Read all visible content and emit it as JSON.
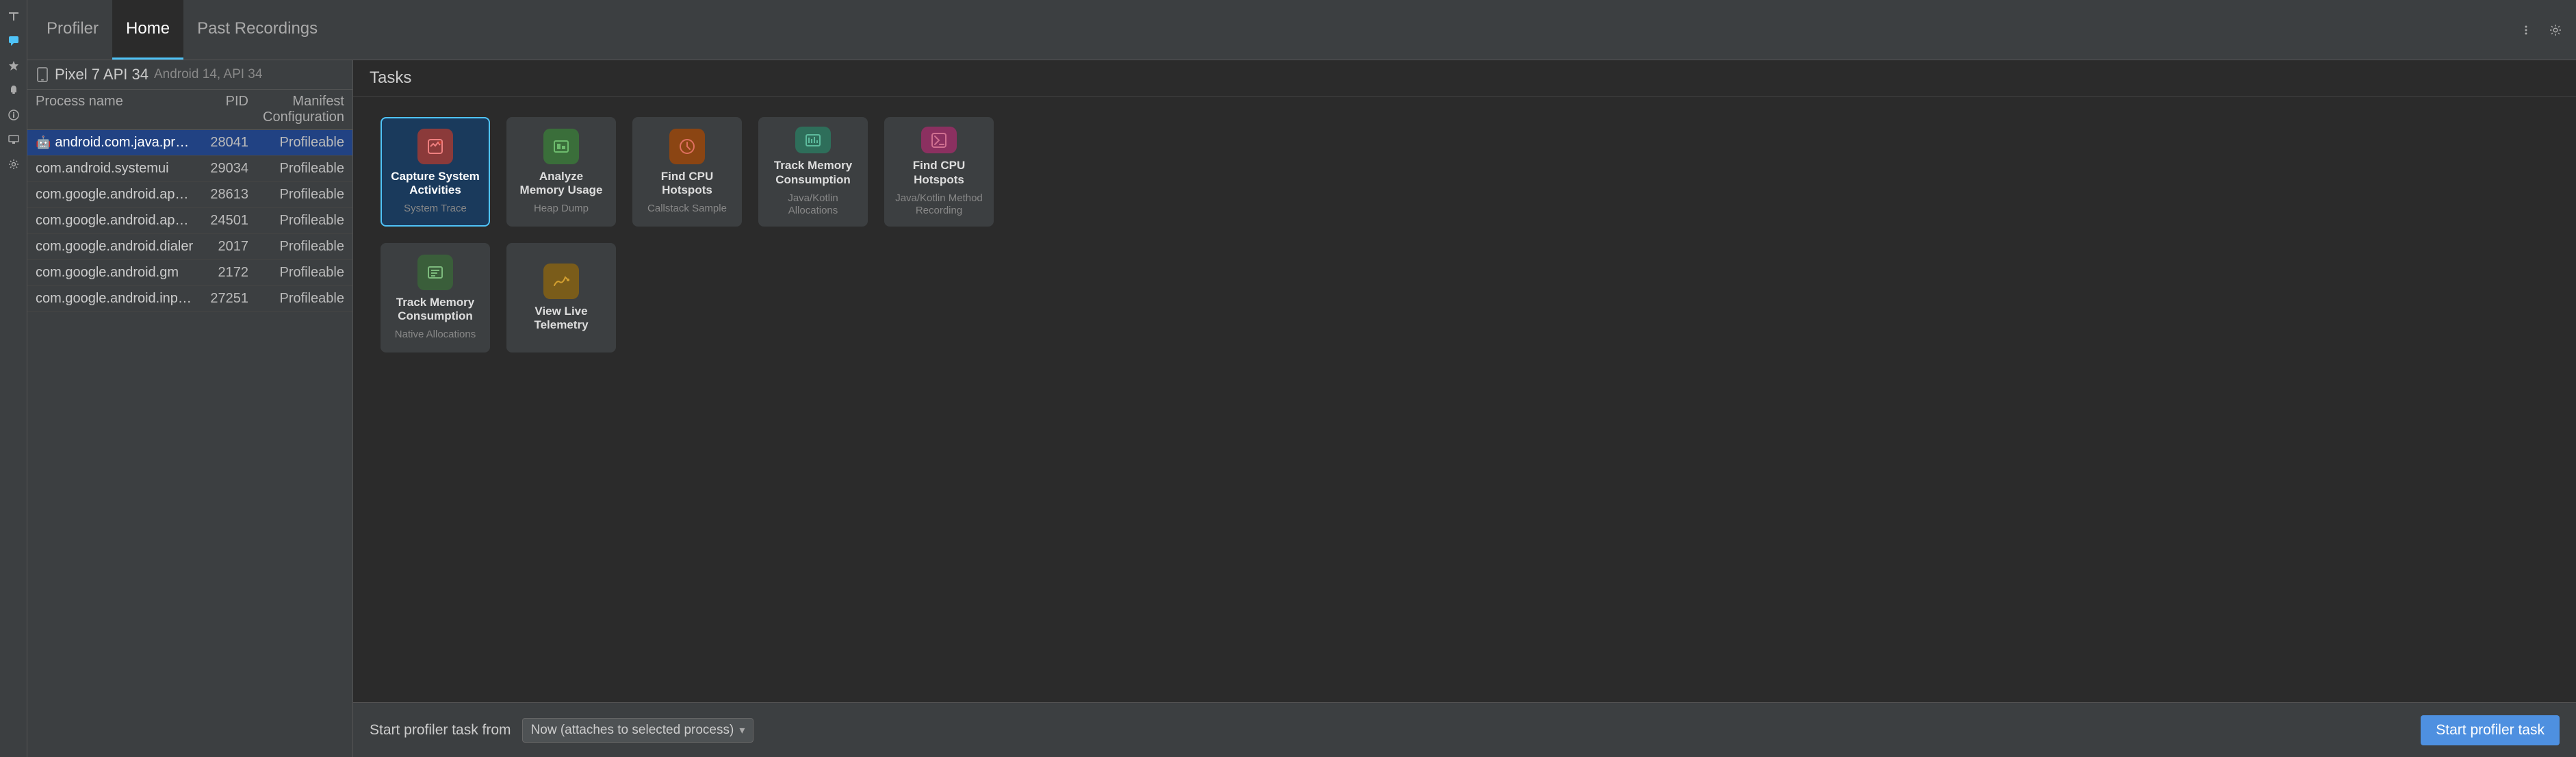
{
  "tabs": {
    "profiler": "Profiler",
    "home": "Home",
    "past_recordings": "Past Recordings"
  },
  "device": {
    "name": "Pixel 7 API 34",
    "sub": "Android 14, API 34"
  },
  "table": {
    "headers": [
      "Process name",
      "PID",
      "Manifest Configuration"
    ],
    "rows": [
      {
        "name": "android.com.java.profilertester",
        "pid": "28041",
        "manifest": "Profileable",
        "selected": true
      },
      {
        "name": "com.android.systemui",
        "pid": "29034",
        "manifest": "Profileable",
        "selected": false
      },
      {
        "name": "com.google.android.apps.messaging",
        "pid": "28613",
        "manifest": "Profileable",
        "selected": false
      },
      {
        "name": "com.google.android.apps.messaging...",
        "pid": "24501",
        "manifest": "Profileable",
        "selected": false
      },
      {
        "name": "com.google.android.dialer",
        "pid": "2017",
        "manifest": "Profileable",
        "selected": false
      },
      {
        "name": "com.google.android.gm",
        "pid": "2172",
        "manifest": "Profileable",
        "selected": false
      },
      {
        "name": "com.google.android.inputmethod.latin",
        "pid": "27251",
        "manifest": "Profileable",
        "selected": false
      }
    ]
  },
  "tasks": {
    "header": "Tasks",
    "items": [
      {
        "id": "system-trace",
        "title": "Capture System Activities",
        "subtitle": "System Trace",
        "icon_char": "⚙",
        "icon_class": "icon-red",
        "selected": true,
        "row": 1
      },
      {
        "id": "heap-dump",
        "title": "Analyze Memory Usage",
        "subtitle": "Heap Dump",
        "icon_char": "🧩",
        "icon_class": "icon-green",
        "selected": false,
        "row": 1
      },
      {
        "id": "callstack-sample",
        "title": "Find CPU Hotspots",
        "subtitle": "Callstack Sample",
        "icon_char": "🔥",
        "icon_class": "icon-orange-red",
        "selected": false,
        "row": 1
      },
      {
        "id": "java-kotlin-alloc",
        "title": "Track Memory Consumption",
        "subtitle": "Java/Kotlin Allocations",
        "icon_char": "📊",
        "icon_class": "icon-teal",
        "selected": false,
        "row": 1
      },
      {
        "id": "java-kotlin-method",
        "title": "Find CPU Hotspots",
        "subtitle": "Java/Kotlin Method Recording",
        "icon_char": "🔥",
        "icon_class": "icon-pink",
        "selected": false,
        "row": 1
      },
      {
        "id": "native-alloc",
        "title": "Track Memory Consumption",
        "subtitle": "Native Allocations",
        "icon_char": "📋",
        "icon_class": "icon-green2",
        "selected": false,
        "row": 2
      },
      {
        "id": "live-telemetry",
        "title": "View Live Telemetry",
        "subtitle": "",
        "icon_char": "📈",
        "icon_class": "icon-amber",
        "selected": false,
        "row": 2
      }
    ]
  },
  "bottom_bar": {
    "label": "Start profiler task from",
    "select_value": "Now (attaches to selected process)",
    "start_btn": "Start profiler task"
  },
  "sidebar_icons": [
    "T",
    "💬",
    "⭐",
    "🔔",
    "ℹ",
    "📺",
    "⚙"
  ]
}
